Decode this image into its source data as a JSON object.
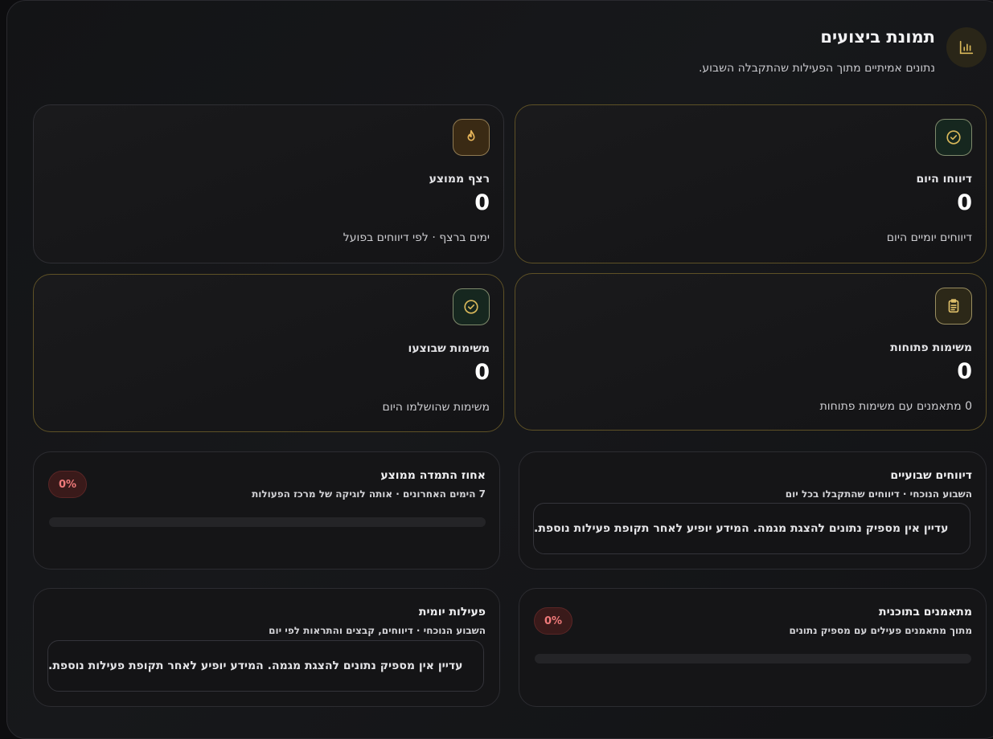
{
  "header": {
    "title": "תמונת ביצועים",
    "subtitle": "נתונים אמיתיים מתוך הפעילות שהתקבלה השבוע."
  },
  "stats": {
    "reported_today": {
      "label": "דיווחו היום",
      "value": "0",
      "desc": "דיווחים יומיים היום",
      "icon": "check-circle-icon"
    },
    "avg_streak": {
      "label": "רצף ממוצע",
      "value": "0",
      "desc": "ימים ברצף · לפי דיווחים בפועל",
      "icon": "flame-icon"
    },
    "open_tasks": {
      "label": "משימות פתוחות",
      "value": "0",
      "desc": "0 מתאמנים עם משימות פתוחות",
      "icon": "clipboard-icon"
    },
    "done_tasks": {
      "label": "משימות שבוצעו",
      "value": "0",
      "desc": "משימות שהושלמו היום",
      "icon": "check-circle-icon"
    }
  },
  "weekly_reports": {
    "title": "דיווחים שבועיים",
    "subtitle": "השבוע הנוכחי · דיווחים שהתקבלו בכל יום",
    "empty": "עדיין אין מספיק נתונים להצגת מגמה. המידע יופיע לאחר תקופת פעילות נוספת."
  },
  "avg_adherence": {
    "title": "אחוז התמדה ממוצע",
    "subtitle": "7 הימים האחרונים · אותה לוגיקה של מרכז הפעולות",
    "badge": "0%",
    "progress": 0
  },
  "on_plan": {
    "title": "מתאמנים בתוכנית",
    "subtitle": "מתוך מתאמנים פעילים עם מספיק נתונים",
    "badge": "0%",
    "progress": 0
  },
  "daily_activity": {
    "title": "פעילות יומית",
    "subtitle": "השבוע הנוכחי · דיווחים, קבצים והתראות לפי יום",
    "empty": "עדיין אין מספיק נתונים להצגת מגמה. המידע יופיע לאחר תקופת פעילות נוספת."
  },
  "colors": {
    "accent_gold": "#c9a84a",
    "badge_red": "#f07a7a",
    "background": "#0d0d0f"
  }
}
